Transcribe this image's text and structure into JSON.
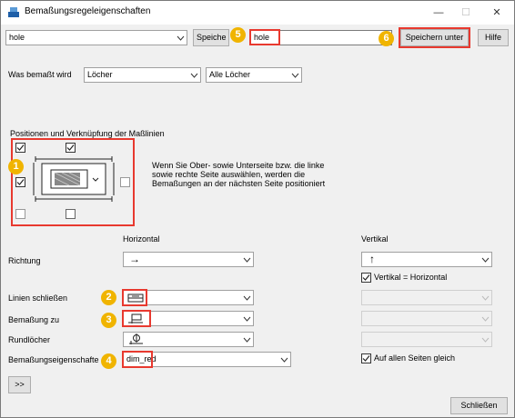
{
  "window": {
    "title": "Bemaßungsregeleigenschaften"
  },
  "toolbar": {
    "preset_value": "hole",
    "save_label_partial": "Speiche",
    "name_value": "hole",
    "save_as_label": "Speichern unter",
    "help_label": "Hilfe"
  },
  "dimensioned": {
    "label": "Was bemaßt wird",
    "type_value": "Löcher",
    "scope_value": "Alle Löcher"
  },
  "positions": {
    "group_label": "Positionen und Verknüpfung der Maßlinien",
    "hint_text_line1": "Wenn Sie Ober- sowie Unterseite bzw. die linke",
    "hint_text_line2": "sowie rechte Seite auswählen, werden die",
    "hint_text_line3": "Bemaßungen an der nächsten Seite positioniert"
  },
  "headers": {
    "horizontal": "Horizontal",
    "vertical": "Vertikal"
  },
  "rows": {
    "direction": {
      "label": "Richtung",
      "h_symbol": "→",
      "v_symbol": "↑"
    },
    "vertical_equals_horizontal": "Vertikal = Horizontal",
    "close_lines": "Linien schließen",
    "dimension_to": "Bemaßung zu",
    "round_holes": "Rundlöcher",
    "dim_props": {
      "label": "Bemaßungseigenschafte",
      "value": "dim_red"
    },
    "same_all_sides": "Auf allen Seiten gleich"
  },
  "buttons": {
    "expand": ">>",
    "close": "Schließen"
  },
  "markers": [
    "1",
    "2",
    "3",
    "4",
    "5",
    "6"
  ],
  "colors": {
    "highlight": "#e8392f",
    "marker": "#f0b400"
  }
}
